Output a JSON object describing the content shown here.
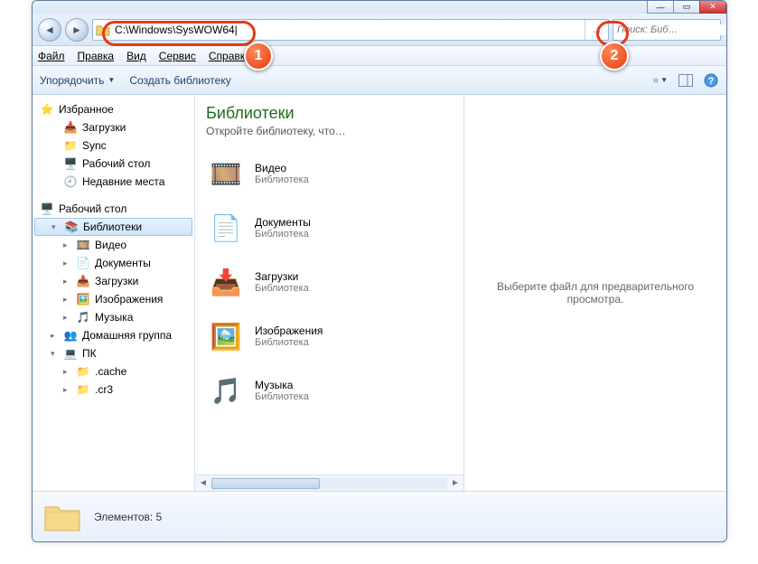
{
  "titlebar": {
    "min": "—",
    "max": "▭",
    "close": "✕"
  },
  "nav": {
    "back": "◄",
    "forward": "►",
    "address": "C:\\Windows\\SysWOW64|",
    "go": "→",
    "search_placeholder": "Поиск: Биб…"
  },
  "menu": {
    "file": "Файл",
    "edit": "Правка",
    "view": "Вид",
    "tools": "Сервис",
    "help": "Справка"
  },
  "toolbar": {
    "organize": "Упорядочить",
    "new_library": "Создать библиотеку"
  },
  "sidebar": {
    "favorites": "Избранное",
    "downloads": "Загрузки",
    "sync": "Sync",
    "desktop": "Рабочий стол",
    "recent": "Недавние места",
    "desktop2": "Рабочий стол",
    "libraries": "Библиотеки",
    "videos": "Видео",
    "documents": "Документы",
    "downloads2": "Загрузки",
    "pictures": "Изображения",
    "music": "Музыка",
    "homegroup": "Домашняя группа",
    "pc": "ПК",
    "cache": ".cache",
    "cr3": ".cr3"
  },
  "content": {
    "title": "Библиотеки",
    "subtitle": "Откройте библиотеку, что…",
    "lib_sub": "Библиотека",
    "items": {
      "videos": "Видео",
      "documents": "Документы",
      "downloads": "Загрузки",
      "pictures": "Изображения",
      "music": "Музыка"
    }
  },
  "preview": {
    "text": "Выберите файл для предварительного просмотра."
  },
  "status": {
    "text": "Элементов: 5"
  },
  "callouts": {
    "c1": "1",
    "c2": "2"
  }
}
